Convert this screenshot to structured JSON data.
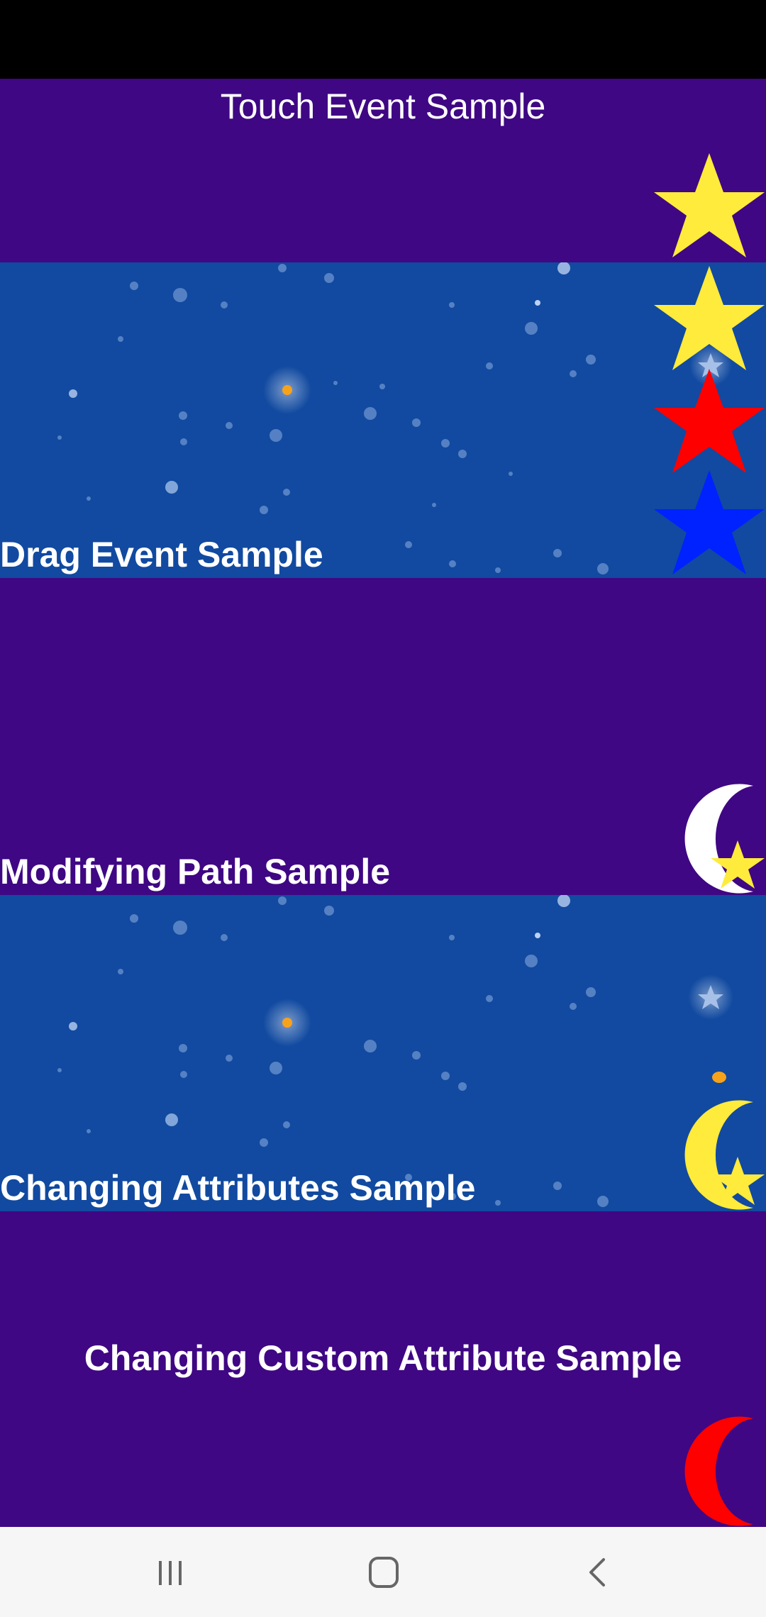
{
  "titles": {
    "touch_event": "Touch Event Sample",
    "drag_event": "Drag Event Sample",
    "modifying_path": "Modifying Path Sample",
    "changing_attributes": "Changing Attributes Sample",
    "changing_custom_attribute": "Changing Custom Attribute Sample"
  },
  "colors": {
    "purple_bg": "#3f0783",
    "night_bg": "#114aa0",
    "star_yellow": "#ffeb3b",
    "star_red": "#ff0000",
    "star_blue": "#0022ff",
    "moon_white": "#ffffff",
    "moon_yellow": "#ffeb3b",
    "moon_red": "#ff0000"
  },
  "icons": {
    "nav_recents": "recents-icon",
    "nav_home": "home-icon",
    "nav_back": "back-icon"
  }
}
